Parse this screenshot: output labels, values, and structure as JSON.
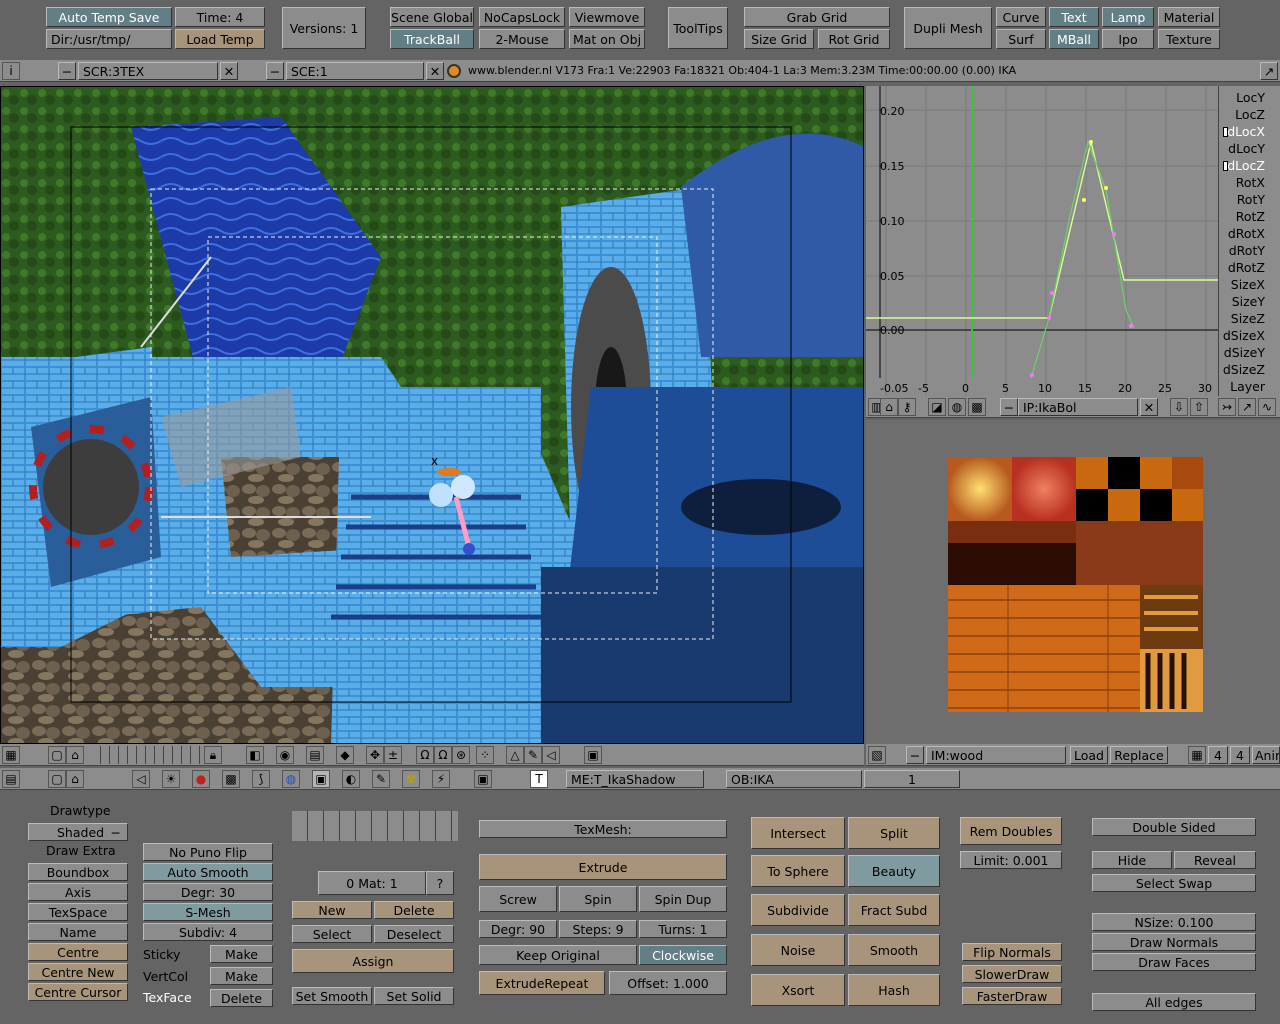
{
  "top": {
    "auto_temp_save": "Auto Temp Save",
    "dir": "Dir:/usr/tmp/",
    "time": "Time: 4",
    "load_temp": "Load Temp",
    "versions": "Versions: 1",
    "scene_global": "Scene Global",
    "trackball": "TrackBall",
    "nocapslock": "NoCapsLock",
    "two_mouse": "2-Mouse",
    "viewmove": "Viewmove",
    "mat_on_obj": "Mat on Obj",
    "tooltips": "ToolTips",
    "grab_grid": "Grab Grid",
    "size_grid": "Size Grid",
    "rot_grid": "Rot Grid",
    "dupli_mesh": "Dupli Mesh",
    "curve": "Curve",
    "surf": "Surf",
    "text": "Text",
    "mball": "MBall",
    "lamp": "Lamp",
    "ipo": "Ipo",
    "material": "Material",
    "texture": "Texture"
  },
  "info": {
    "screen": "SCR:3TEX",
    "scene": "SCE:1",
    "status": "www.blender.nl V173  Fra:1  Ve:22903 Fa:18321  Ob:404-1 La:3  Mem:3.23M Time:00:00.00 (0.00)  IKA"
  },
  "ipo": {
    "channels": [
      "LocY",
      "LocZ",
      "dLocX",
      "dLocY",
      "dLocZ",
      "RotX",
      "RotY",
      "RotZ",
      "dRotX",
      "dRotY",
      "dRotZ",
      "SizeX",
      "SizeY",
      "SizeZ",
      "dSizeX",
      "dSizeY",
      "dSizeZ",
      "Layer"
    ],
    "yticks": [
      "0.20",
      "0.15",
      "0.10",
      "0.05",
      "0.00"
    ],
    "xticks": [
      "-0.05",
      "-5",
      "0",
      "5",
      "10",
      "15",
      "20",
      "25",
      "30"
    ],
    "block": "IP:IkaBol"
  },
  "image": {
    "name": "IM:wood",
    "load": "Load",
    "replace": "Replace",
    "n1": "4",
    "n2": "4",
    "anim": "Anim"
  },
  "buttons_header": {
    "mesh": "ME:T_IkaShadow",
    "object": "OB:IKA",
    "value": "1"
  },
  "edit": {
    "drawtype": "Drawtype",
    "shaded": "Shaded",
    "draw_extra": "Draw Extra",
    "boundbox": "Boundbox",
    "axis": "Axis",
    "texspace": "TexSpace",
    "name": "Name",
    "centre": "Centre",
    "centre_new": "Centre New",
    "centre_cursor": "Centre Cursor",
    "no_puno_flip": "No Puno Flip",
    "auto_smooth": "Auto Smooth",
    "degr30": "Degr: 30",
    "smesh": "S-Mesh",
    "subdiv": "Subdiv: 4",
    "sticky": "Sticky",
    "vertcol": "VertCol",
    "texface": "TexFace",
    "make1": "Make",
    "make2": "Make",
    "delete_tf": "Delete",
    "mat": "0 Mat: 1",
    "q": "?",
    "new": "New",
    "delete": "Delete",
    "select": "Select",
    "deselect": "Deselect",
    "assign": "Assign",
    "set_smooth": "Set Smooth",
    "set_solid": "Set Solid",
    "texmesh": "TexMesh:",
    "extrude": "Extrude",
    "screw": "Screw",
    "spin": "Spin",
    "spin_dup": "Spin Dup",
    "degr90": "Degr: 90",
    "steps": "Steps: 9",
    "turns": "Turns: 1",
    "keep_original": "Keep Original",
    "clockwise": "Clockwise",
    "extrude_repeat": "ExtrudeRepeat",
    "offset": "Offset: 1.000",
    "intersect": "Intersect",
    "split": "Split",
    "to_sphere": "To Sphere",
    "beauty": "Beauty",
    "subdivide": "Subdivide",
    "fract_subd": "Fract Subd",
    "noise": "Noise",
    "smooth": "Smooth",
    "xsort": "Xsort",
    "hash": "Hash",
    "rem_doubles": "Rem Doubles",
    "limit": "Limit: 0.001",
    "flip_normals": "Flip Normals",
    "slower_draw": "SlowerDraw",
    "faster_draw": "FasterDraw",
    "double_sided": "Double Sided",
    "hide": "Hide",
    "reveal": "Reveal",
    "select_swap": "Select Swap",
    "nsize": "NSize: 0.100",
    "draw_normals": "Draw Normals",
    "draw_faces": "Draw Faces",
    "all_edges": "All edges"
  }
}
